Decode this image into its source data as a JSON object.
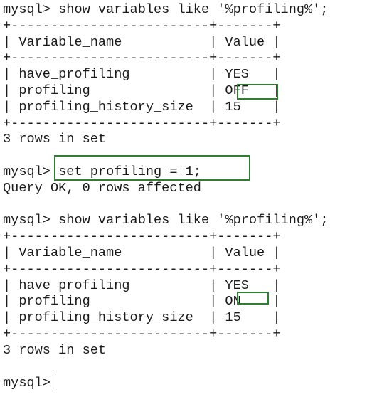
{
  "terminal": {
    "prompt": "mysql>",
    "query1": {
      "command": "show variables like '%profiling%';",
      "border": "+-------------------------+-------+",
      "header": "| Variable_name           | Value |",
      "rows": [
        "| have_profiling          | YES   |",
        "| profiling               | OFF   |",
        "| profiling_history_size  | 15    |"
      ],
      "footer": "3 rows in set"
    },
    "set_command": {
      "command": "set profiling = 1;",
      "result": "Query OK, 0 rows affected"
    },
    "query2": {
      "command": "show variables like '%profiling%';",
      "border": "+-------------------------+-------+",
      "header": "| Variable_name           | Value |",
      "rows": [
        "| have_profiling          | YES   |",
        "| profiling               | ON    |",
        "| profiling_history_size  | 15    |"
      ],
      "footer": "3 rows in set"
    }
  },
  "colors": {
    "text": "#1a1a1a",
    "highlight": "#2e7d32",
    "background": "#ffffff"
  }
}
